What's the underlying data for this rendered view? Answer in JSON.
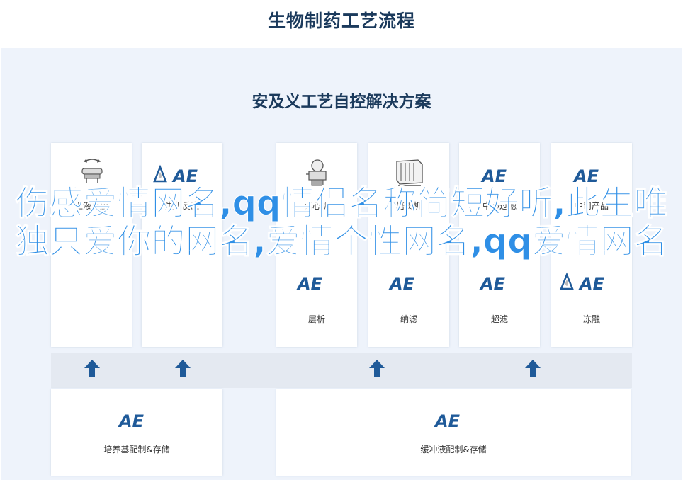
{
  "header": {
    "title": "生物制药工艺流程"
  },
  "panel": {
    "title": "安及义工艺自控解决方案"
  },
  "top_cards": [
    {
      "label": "上液反应",
      "icon": "stirred-tank-icon"
    },
    {
      "label": "生化反应",
      "icon": "ae-logo-icon"
    },
    {
      "label": "离心机",
      "icon": "centrifuge-icon"
    },
    {
      "label": "培质机",
      "icon": "press-machine-icon"
    },
    {
      "label": "中心过滤",
      "icon": "ae-logo-icon"
    },
    {
      "label": "中司产品",
      "icon": "ae-logo-icon"
    }
  ],
  "second_cards": [
    {
      "label": "层析"
    },
    {
      "label": "纳滤"
    },
    {
      "label": "超滤"
    },
    {
      "label": "冻融"
    }
  ],
  "bottom_cards": [
    {
      "label": "培养基配制&存储"
    },
    {
      "label": "缓冲液配制&存储"
    }
  ],
  "overlay": {
    "text": "伤感爱情网名,qq情侣名称简短好听,此生唯独只爱你的网名,爱情个性网名,qq爱情网名"
  },
  "colors": {
    "brand": "#1f5a99",
    "accent_text": "#2f8fe6",
    "panel_bg": "#eef3fb",
    "arrow": "#1f5a99"
  }
}
